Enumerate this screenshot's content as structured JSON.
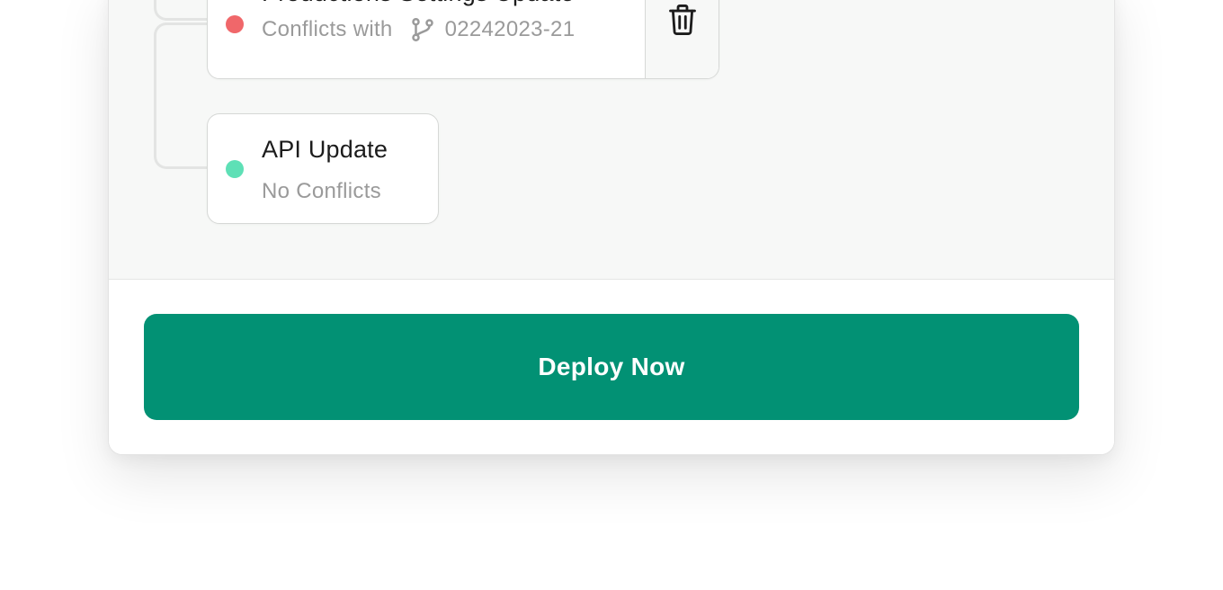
{
  "branches": [
    {
      "title": "Productions Settings Update",
      "status": "conflict",
      "status_color": "#f0676a",
      "subtitle": "Conflicts with",
      "conflict_icon": "git-branch-icon",
      "conflict_branch": "02242023-21",
      "action_icon": "trash-icon"
    },
    {
      "title": "API Update",
      "status": "clean",
      "status_color": "#5ee0b6",
      "subtitle": "No Conflicts"
    }
  ],
  "footer": {
    "deploy_label": "Deploy Now",
    "deploy_color": "#029174"
  }
}
